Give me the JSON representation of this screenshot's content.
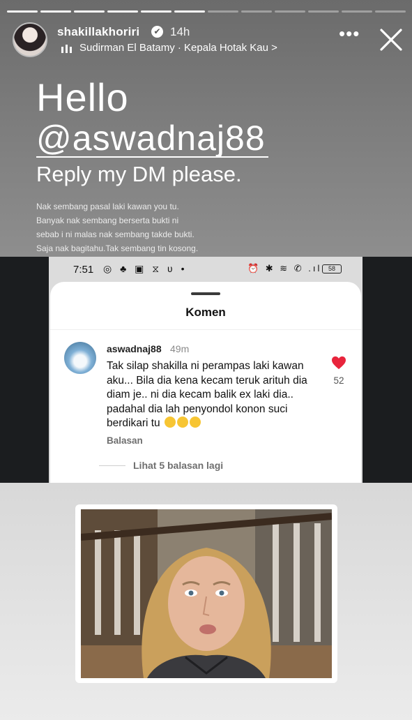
{
  "progress": {
    "segments": 12,
    "completed": 6
  },
  "header": {
    "username": "shakillakhoriri",
    "verified": "✔",
    "time": "14h",
    "music": "Sudirman El Batamy · Kepala Hotak Kau >",
    "more": "•••"
  },
  "story": {
    "hello": "Hello",
    "mention": "@aswadnaj88",
    "reply": "Reply my DM please.",
    "lines": [
      "Nak sembang pasal laki kawan you tu.",
      "Banyak nak sembang berserta bukti ni",
      "sebab i ni malas nak sembang takde bukti.",
      "Saja nak bagitahu.Tak sembang tin kosong."
    ]
  },
  "screenshot": {
    "status_time": "7:51",
    "status_left_icons": "◎ ♣ ▣ ⧖ ʋ •",
    "status_right_icons": "⏰ ✱ ≋ ✆ .ıl",
    "battery": "58",
    "sheet_title": "Komen",
    "comment": {
      "user": "aswadnaj88",
      "time": "49m",
      "text": "Tak silap shakilla ni perampas laki kawan aku... Bila dia kena kecam teruk arituh dia diam je.. ni dia kecam balik ex laki dia.. padahal dia lah penyondol konon suci berdikari tu",
      "reply_label": "Balasan",
      "likes": "52"
    },
    "more_replies": "Lihat 5 balasan lagi"
  },
  "colors": {
    "heart": "#e8243c",
    "story_grey": "#7c7c7c",
    "emoji": "#f7c533"
  }
}
